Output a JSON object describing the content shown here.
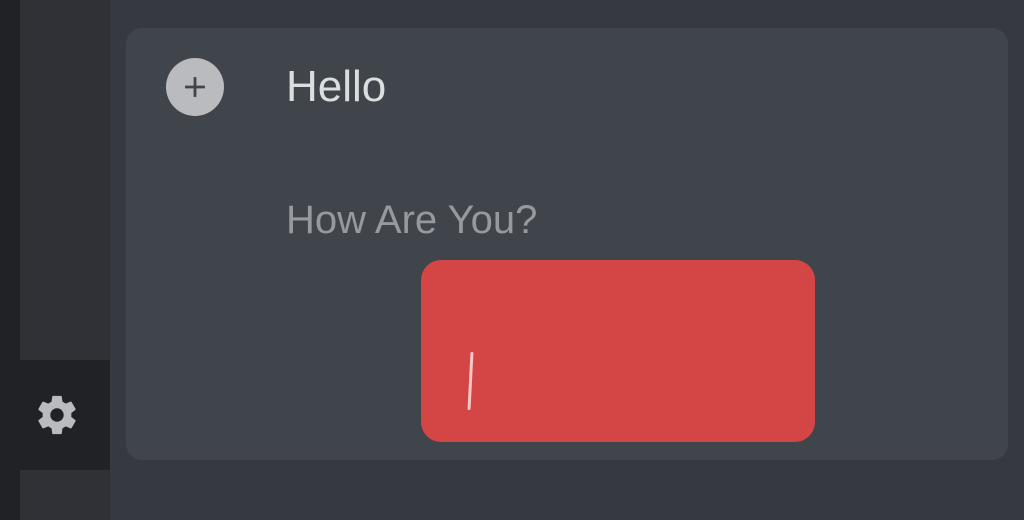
{
  "sidebar": {
    "settings_label": "Settings"
  },
  "message_input": {
    "line1": "Hello",
    "line2": "How Are  You?"
  },
  "colors": {
    "cover": "#d44545",
    "bg_main": "#36393f",
    "bg_input": "#40444b"
  }
}
